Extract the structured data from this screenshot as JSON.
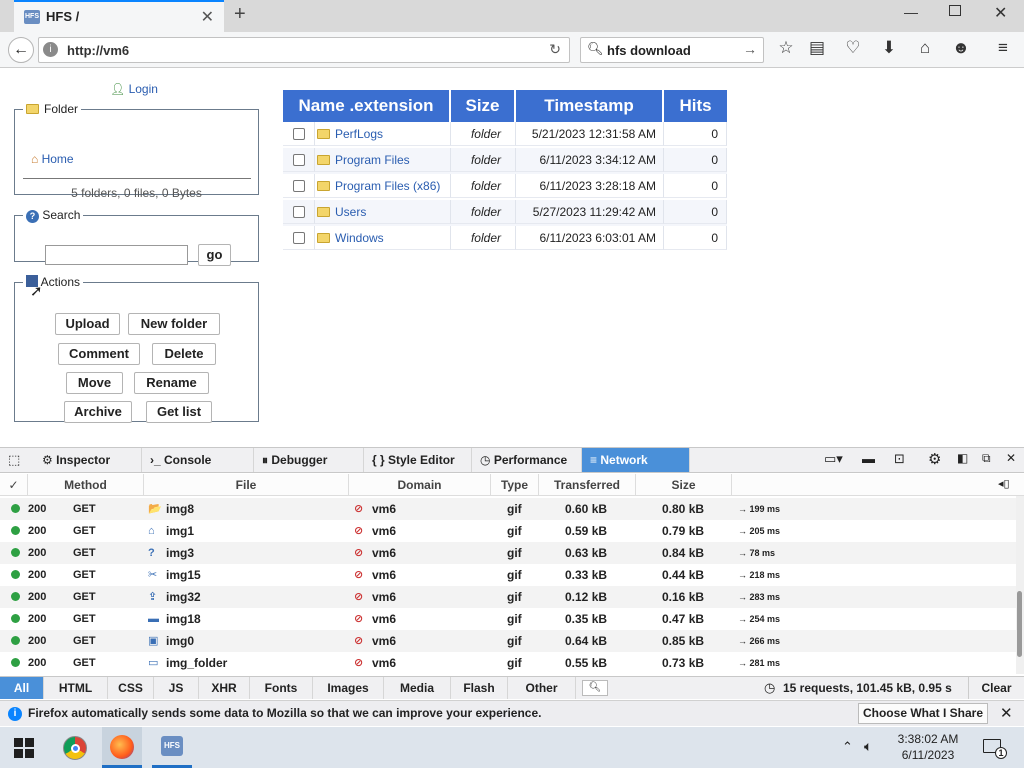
{
  "browser": {
    "tab_title": "HFS /",
    "url": "http://vm6",
    "search_text": "hfs download"
  },
  "hfs": {
    "login": "Login",
    "folder_legend": "Folder",
    "home": "Home",
    "folder_summary": "5 folders, 0 files, 0 Bytes",
    "search_legend": "Search",
    "go": "go",
    "actions_legend": "Actions",
    "actions": [
      "Upload",
      "New folder",
      "Comment",
      "Delete",
      "Move",
      "Rename",
      "Archive",
      "Get list"
    ],
    "columns": [
      "Name .extension",
      "Size",
      "Timestamp",
      "Hits"
    ],
    "files": [
      {
        "name": "PerfLogs",
        "size": "folder",
        "timestamp": "5/21/2023 12:31:58 AM",
        "hits": "0"
      },
      {
        "name": "Program Files",
        "size": "folder",
        "timestamp": "6/11/2023 3:34:12 AM",
        "hits": "0"
      },
      {
        "name": "Program Files (x86)",
        "size": "folder",
        "timestamp": "6/11/2023 3:28:18 AM",
        "hits": "0"
      },
      {
        "name": "Users",
        "size": "folder",
        "timestamp": "5/27/2023 11:29:42 AM",
        "hits": "0"
      },
      {
        "name": "Windows",
        "size": "folder",
        "timestamp": "6/11/2023 6:03:01 AM",
        "hits": "0"
      }
    ]
  },
  "devtools": {
    "tabs": [
      "Inspector",
      "Console",
      "Debugger",
      "{ } Style Editor",
      "Performance",
      "Network"
    ],
    "columns": [
      "✓",
      "Method",
      "File",
      "Domain",
      "Type",
      "Transferred",
      "Size"
    ],
    "requests": [
      {
        "status": "200",
        "method": "GET",
        "file": "img8",
        "domain": "vm6",
        "type": "gif",
        "transferred": "0.60 kB",
        "size": "0.80 kB",
        "time": "→ 199 ms"
      },
      {
        "status": "200",
        "method": "GET",
        "file": "img1",
        "domain": "vm6",
        "type": "gif",
        "transferred": "0.59 kB",
        "size": "0.79 kB",
        "time": "→ 205 ms"
      },
      {
        "status": "200",
        "method": "GET",
        "file": "img3",
        "domain": "vm6",
        "type": "gif",
        "transferred": "0.63 kB",
        "size": "0.84 kB",
        "time": "→ 78 ms"
      },
      {
        "status": "200",
        "method": "GET",
        "file": "img15",
        "domain": "vm6",
        "type": "gif",
        "transferred": "0.33 kB",
        "size": "0.44 kB",
        "time": "→ 218 ms"
      },
      {
        "status": "200",
        "method": "GET",
        "file": "img32",
        "domain": "vm6",
        "type": "gif",
        "transferred": "0.12 kB",
        "size": "0.16 kB",
        "time": "→ 283 ms"
      },
      {
        "status": "200",
        "method": "GET",
        "file": "img18",
        "domain": "vm6",
        "type": "gif",
        "transferred": "0.35 kB",
        "size": "0.47 kB",
        "time": "→ 254 ms"
      },
      {
        "status": "200",
        "method": "GET",
        "file": "img0",
        "domain": "vm6",
        "type": "gif",
        "transferred": "0.64 kB",
        "size": "0.85 kB",
        "time": "→ 266 ms"
      },
      {
        "status": "200",
        "method": "GET",
        "file": "img_folder",
        "domain": "vm6",
        "type": "gif",
        "transferred": "0.55 kB",
        "size": "0.73 kB",
        "time": "→ 281 ms"
      }
    ],
    "filters": [
      "All",
      "HTML",
      "CSS",
      "JS",
      "XHR",
      "Fonts",
      "Images",
      "Media",
      "Flash",
      "Other"
    ],
    "summary": "15 requests, 101.45 kB, 0.95 s",
    "clear": "Clear"
  },
  "notification": {
    "text": "Firefox automatically sends some data to Mozilla so that we can improve your experience.",
    "button": "Choose What I Share"
  },
  "taskbar": {
    "time": "3:38:02 AM",
    "date": "6/11/2023",
    "badge": "1"
  }
}
